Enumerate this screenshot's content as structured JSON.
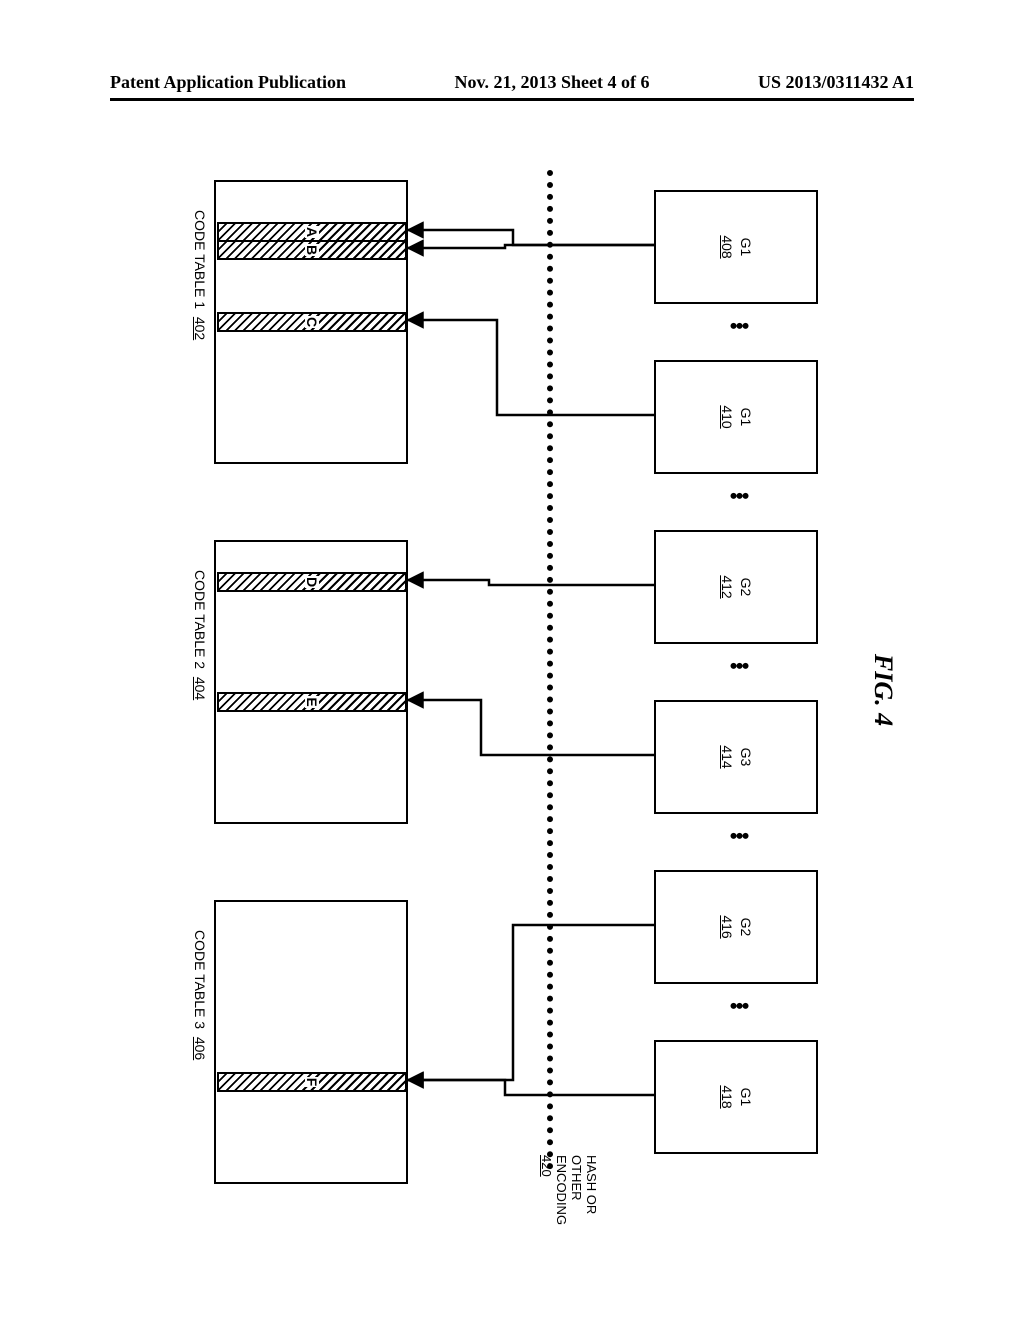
{
  "header": {
    "left": "Patent Application Publication",
    "center": "Nov. 21, 2013  Sheet 4 of 6",
    "right": "US 2013/0311432 A1"
  },
  "figure_label": "FIG. 4",
  "divider": {
    "label_line1": "HASH OR",
    "label_line2": "OTHER",
    "label_line3": "ENCODING",
    "ref": "420"
  },
  "top_boxes": [
    {
      "name": "G1",
      "ref": "408"
    },
    {
      "name": "G1",
      "ref": "410"
    },
    {
      "name": "G2",
      "ref": "412"
    },
    {
      "name": "G3",
      "ref": "414"
    },
    {
      "name": "G2",
      "ref": "416"
    },
    {
      "name": "G1",
      "ref": "418"
    }
  ],
  "code_tables": [
    {
      "caption": "CODE TABLE 1",
      "ref": "402",
      "entries": [
        {
          "label": "A"
        },
        {
          "label": "B"
        },
        {
          "label": "C"
        }
      ]
    },
    {
      "caption": "CODE TABLE 2",
      "ref": "404",
      "entries": [
        {
          "label": "D"
        },
        {
          "label": "E"
        }
      ]
    },
    {
      "caption": "CODE TABLE 3",
      "ref": "406",
      "entries": [
        {
          "label": "F"
        }
      ]
    }
  ],
  "arrows": [
    {
      "from_box": 0,
      "to_table": 0,
      "to_entry_label": "A"
    },
    {
      "from_box": 0,
      "to_table": 0,
      "to_entry_label": "B"
    },
    {
      "from_box": 1,
      "to_table": 0,
      "to_entry_label": "C"
    },
    {
      "from_box": 2,
      "to_table": 1,
      "to_entry_label": "D"
    },
    {
      "from_box": 3,
      "to_table": 1,
      "to_entry_label": "E"
    },
    {
      "from_box": 4,
      "to_table": 2,
      "to_entry_label": "F"
    },
    {
      "from_box": 5,
      "to_table": 2,
      "to_entry_label": "F"
    }
  ]
}
